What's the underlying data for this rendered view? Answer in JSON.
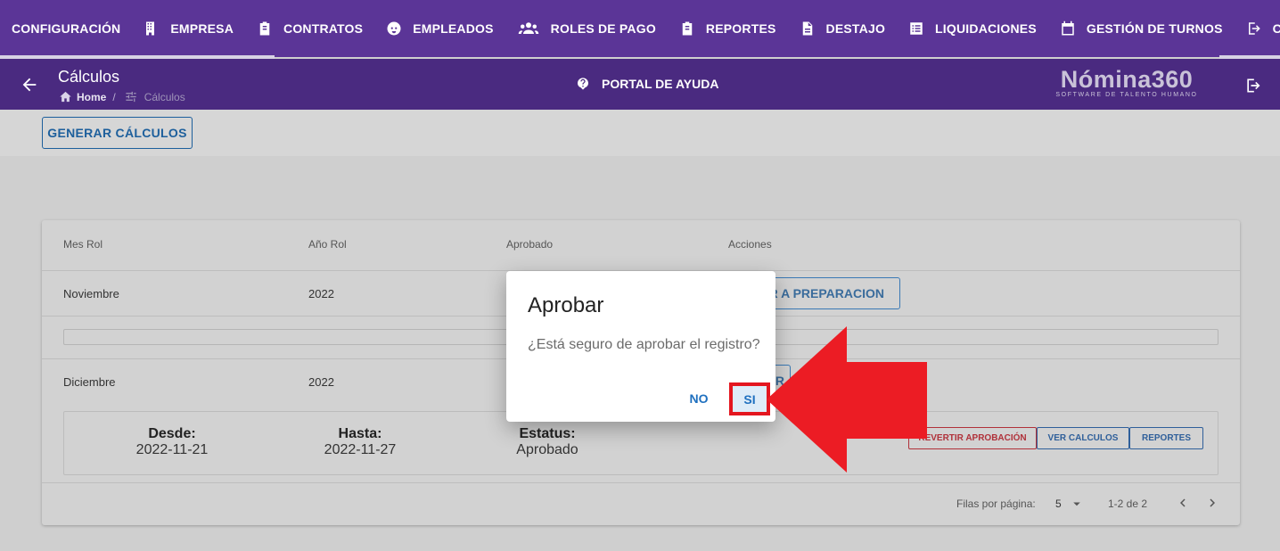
{
  "nav": {
    "items": [
      {
        "label": "CONFIGURACIÓN",
        "icon": ""
      },
      {
        "label": "EMPRESA",
        "icon": "building-icon"
      },
      {
        "label": "CONTRATOS",
        "icon": "clipboard-icon"
      },
      {
        "label": "EMPLEADOS",
        "icon": "face-icon"
      },
      {
        "label": "ROLES DE PAGO",
        "icon": "people-icon"
      },
      {
        "label": "REPORTES",
        "icon": "clipboard-icon"
      },
      {
        "label": "DESTAJO",
        "icon": "document-icon"
      },
      {
        "label": "LIQUIDACIONES",
        "icon": "list-icon"
      },
      {
        "label": "GESTIÓN DE TURNOS",
        "icon": "calendar-icon"
      },
      {
        "label": "CERRA",
        "icon": "logout-icon"
      }
    ]
  },
  "header": {
    "title": "Cálculos",
    "breadcrumb_home": "Home",
    "breadcrumb_sep": "/",
    "breadcrumb_current": "Cálculos",
    "help_label": "PORTAL DE AYUDA",
    "brand_name": "Nómina360",
    "brand_tagline": "SOFTWARE DE TALENTO HUMANO"
  },
  "toolbar": {
    "generate_label": "GENERAR CÁLCULOS"
  },
  "table": {
    "headers": [
      "Mes Rol",
      "Año Rol",
      "Aprobado",
      "Acciones"
    ],
    "rows": [
      {
        "mes": "Noviembre",
        "anio": "2022",
        "action": "AR A PREPARACION"
      },
      {
        "mes": "Diciembre",
        "anio": "2022",
        "action": "AR"
      }
    ],
    "detail": {
      "desde_label": "Desde:",
      "desde_value": "2022-11-21",
      "hasta_label": "Hasta:",
      "hasta_value": "2022-11-27",
      "estatus_label": "Estatus:",
      "estatus_value": "Aprobado",
      "revert_label": "REVERTIR APROBACIÓN",
      "ver_label": "VER CALCULOS",
      "reportes_label": "REPORTES"
    },
    "footer": {
      "rows_per_page_label": "Filas por página:",
      "rows_per_page_value": "5",
      "range": "1-2 de 2"
    }
  },
  "dialog": {
    "title": "Aprobar",
    "message": "¿Está seguro de aprobar el registro?",
    "no_label": "NO",
    "yes_label": "SI"
  },
  "colors": {
    "nav_bg": "#5b3597",
    "subheader_bg": "#4a2a80",
    "primary_text": "#1f70bf",
    "highlight_red": "#e4161f"
  }
}
